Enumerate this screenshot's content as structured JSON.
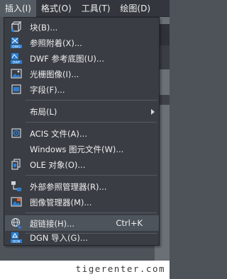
{
  "menubar": {
    "items": [
      {
        "label": "插入(I)"
      },
      {
        "label": "格式(O)"
      },
      {
        "label": "工具(T)"
      },
      {
        "label": "绘图(D)"
      }
    ]
  },
  "menu": {
    "items": [
      {
        "label": "块(B)...",
        "icon": "block-icon"
      },
      {
        "label": "参照附着(X)...",
        "icon": "dwg-reference-icon"
      },
      {
        "label": "DWF 参考底图(U)...",
        "icon": "dwf-icon"
      },
      {
        "label": "光栅图像(I)...",
        "icon": "raster-image-icon"
      },
      {
        "label": "字段(F)...",
        "icon": "field-icon"
      },
      {
        "label": "布局(L)",
        "icon": "",
        "submenu": true
      },
      {
        "label": "ACIS 文件(A)...",
        "icon": "acis-icon"
      },
      {
        "label": "Windows 图元文件(W)...",
        "icon": ""
      },
      {
        "label": "OLE 对象(O)...",
        "icon": "ole-icon"
      },
      {
        "label": "外部参照管理器(R)...",
        "icon": "xref-manager-icon"
      },
      {
        "label": "图像管理器(M)...",
        "icon": "image-manager-icon"
      },
      {
        "label": "超链接(H)...",
        "icon": "hyperlink-icon",
        "shortcut": "Ctrl+K"
      },
      {
        "label": "DGN 导入(G)...",
        "icon": "dgn-icon"
      }
    ]
  },
  "colors": {
    "menu_bg": "#3a3e44",
    "highlight": "#4e545c",
    "icon_blue": "#2a7fd4"
  },
  "footer": {
    "watermark": "tigerenter.com"
  }
}
